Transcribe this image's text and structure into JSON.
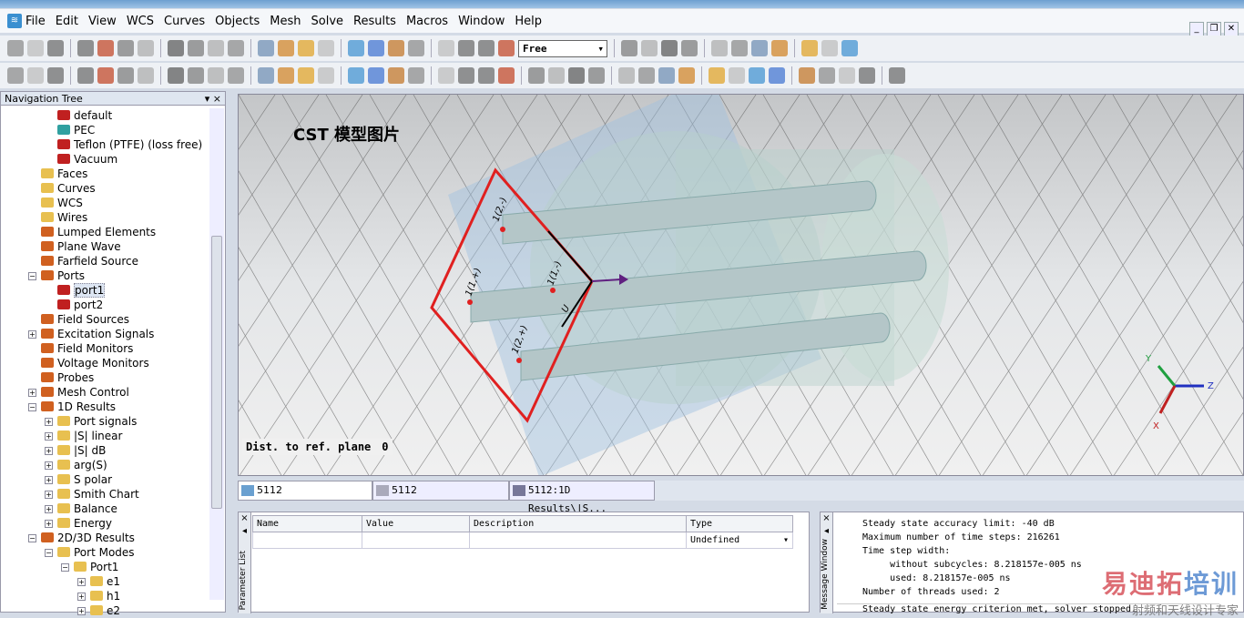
{
  "menu": [
    "File",
    "Edit",
    "View",
    "WCS",
    "Curves",
    "Objects",
    "Mesh",
    "Solve",
    "Results",
    "Macros",
    "Window",
    "Help"
  ],
  "toolbar": {
    "view_mode": "Free"
  },
  "nav": {
    "title": "Navigation Tree",
    "items": [
      {
        "label": "default",
        "level": 2,
        "icon": "red",
        "pm": ""
      },
      {
        "label": "PEC",
        "level": 2,
        "icon": "teal",
        "pm": ""
      },
      {
        "label": "Teflon (PTFE) (loss free)",
        "level": 2,
        "icon": "red",
        "pm": ""
      },
      {
        "label": "Vacuum",
        "level": 2,
        "icon": "red",
        "pm": ""
      },
      {
        "label": "Faces",
        "level": 1,
        "icon": "folder",
        "pm": ""
      },
      {
        "label": "Curves",
        "level": 1,
        "icon": "folder",
        "pm": ""
      },
      {
        "label": "WCS",
        "level": 1,
        "icon": "folder",
        "pm": ""
      },
      {
        "label": "Wires",
        "level": 1,
        "icon": "folder",
        "pm": ""
      },
      {
        "label": "Lumped Elements",
        "level": 1,
        "icon": "gear",
        "pm": ""
      },
      {
        "label": "Plane Wave",
        "level": 1,
        "icon": "gear",
        "pm": ""
      },
      {
        "label": "Farfield Source",
        "level": 1,
        "icon": "gear",
        "pm": ""
      },
      {
        "label": "Ports",
        "level": 1,
        "icon": "gear",
        "pm": "-"
      },
      {
        "label": "port1",
        "level": 2,
        "icon": "port",
        "pm": "",
        "sel": true
      },
      {
        "label": "port2",
        "level": 2,
        "icon": "port",
        "pm": ""
      },
      {
        "label": "Field Sources",
        "level": 1,
        "icon": "gear",
        "pm": ""
      },
      {
        "label": "Excitation Signals",
        "level": 1,
        "icon": "gear",
        "pm": "+"
      },
      {
        "label": "Field Monitors",
        "level": 1,
        "icon": "gear",
        "pm": ""
      },
      {
        "label": "Voltage Monitors",
        "level": 1,
        "icon": "gear",
        "pm": ""
      },
      {
        "label": "Probes",
        "level": 1,
        "icon": "gear",
        "pm": ""
      },
      {
        "label": "Mesh Control",
        "level": 1,
        "icon": "gear",
        "pm": "+"
      },
      {
        "label": "1D Results",
        "level": 1,
        "icon": "gear",
        "pm": "-"
      },
      {
        "label": "Port signals",
        "level": 2,
        "icon": "folder",
        "pm": "+"
      },
      {
        "label": "|S| linear",
        "level": 2,
        "icon": "folder",
        "pm": "+"
      },
      {
        "label": "|S| dB",
        "level": 2,
        "icon": "folder",
        "pm": "+"
      },
      {
        "label": "arg(S)",
        "level": 2,
        "icon": "folder",
        "pm": "+"
      },
      {
        "label": "S polar",
        "level": 2,
        "icon": "folder",
        "pm": "+"
      },
      {
        "label": "Smith Chart",
        "level": 2,
        "icon": "folder",
        "pm": "+"
      },
      {
        "label": "Balance",
        "level": 2,
        "icon": "folder",
        "pm": "+"
      },
      {
        "label": "Energy",
        "level": 2,
        "icon": "folder",
        "pm": "+"
      },
      {
        "label": "2D/3D Results",
        "level": 1,
        "icon": "gear",
        "pm": "-"
      },
      {
        "label": "Port Modes",
        "level": 2,
        "icon": "folder",
        "pm": "-"
      },
      {
        "label": "Port1",
        "level": 3,
        "icon": "folder",
        "pm": "-"
      },
      {
        "label": "e1",
        "level": 4,
        "icon": "folder",
        "pm": "+"
      },
      {
        "label": "h1",
        "level": 4,
        "icon": "folder",
        "pm": "+"
      },
      {
        "label": "e2",
        "level": 4,
        "icon": "folder",
        "pm": "+"
      }
    ]
  },
  "viewport": {
    "title": "CST 模型图片",
    "dist_label": "Dist. to ref. plane",
    "dist_value": "0",
    "port_labels": [
      "1(2,-)",
      "1(1,+)",
      "1(1,-)",
      "1(2,+)",
      "U"
    ],
    "axes": [
      "Y",
      "Z",
      "X"
    ]
  },
  "tabs": [
    "5112",
    "5112",
    "5112:1D Results\\|S..."
  ],
  "param": {
    "side_label": "Parameter List",
    "columns": [
      "Name",
      "Value",
      "Description",
      "Type"
    ],
    "row": [
      "",
      "",
      "",
      "Undefined"
    ]
  },
  "messages": {
    "side_label": "Message Window",
    "lines": [
      "Steady state accuracy limit: -40 dB",
      "Maximum number of time steps: 216261",
      "Time step width:",
      "     without subcycles: 8.218157e-005 ns",
      "     used: 8.218157e-005 ns",
      "Number of threads used: 2"
    ],
    "last": "Steady state energy criterion met, solver stopped."
  },
  "watermark": {
    "line1a": "易迪拓",
    "line1b": "培训",
    "line2": "射频和天线设计专家"
  },
  "colors": {
    "port": "#e02020",
    "accent": "#3a8fd0"
  }
}
